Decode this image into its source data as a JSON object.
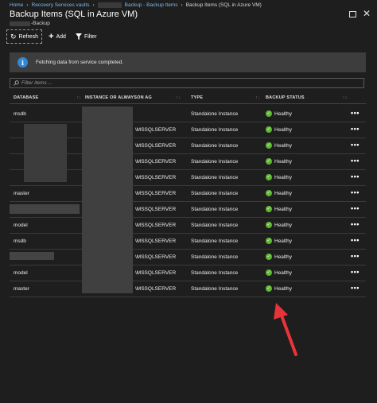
{
  "breadcrumb": {
    "items": [
      "Home",
      "Recovery Services vaults",
      "Backup - Backup Items",
      "Backup Items (SQL in Azure VM)"
    ]
  },
  "header": {
    "title": "Backup Items (SQL in Azure VM)",
    "subtitle_suffix": "-Backup"
  },
  "window": {
    "maximize_icon": "maximize-icon",
    "close_icon": "close-icon",
    "close_glyph": "✕"
  },
  "toolbar": {
    "refresh_label": "Refresh",
    "add_label": "Add",
    "filter_label": "Filter"
  },
  "info": {
    "icon_glyph": "i",
    "message": "Fetching data from service completed."
  },
  "filter": {
    "placeholder": "Filter items ..."
  },
  "table": {
    "headers": {
      "database": "DATABASE",
      "instance": "INSTANCE OR ALWAYSON AG",
      "type": "TYPE",
      "status": "BACKUP STATUS"
    },
    "rows": [
      {
        "database": "msdb",
        "instance": "",
        "type": "Standalone Instance",
        "status": "Healthy"
      },
      {
        "database": "",
        "instance": "\\MSSQLSERVER",
        "type": "Standalone Instance",
        "status": "Healthy"
      },
      {
        "database": "",
        "instance": "\\MSSQLSERVER",
        "type": "Standalone Instance",
        "status": "Healthy"
      },
      {
        "database": "",
        "instance": "\\MSSQLSERVER",
        "type": "Standalone Instance",
        "status": "Healthy"
      },
      {
        "database": "",
        "instance": "\\MSSQLSERVER",
        "type": "Standalone Instance",
        "status": "Healthy"
      },
      {
        "database": "master",
        "instance": "\\MSSQLSERVER",
        "type": "Standalone Instance",
        "status": "Healthy"
      },
      {
        "database": "",
        "instance": "\\MSSQLSERVER",
        "type": "Standalone Instance",
        "status": "Healthy"
      },
      {
        "database": "model",
        "instance": "\\MSSQLSERVER",
        "type": "Standalone Instance",
        "status": "Healthy"
      },
      {
        "database": "msdb",
        "instance": "\\MSSQLSERVER",
        "type": "Standalone Instance",
        "status": "Healthy"
      },
      {
        "database": "",
        "instance": "\\MSSQLSERVER",
        "type": "Standalone Instance",
        "status": "Healthy"
      },
      {
        "database": "model",
        "instance": "\\MSSQLSERVER",
        "type": "Standalone Instance",
        "status": "Healthy"
      },
      {
        "database": "master",
        "instance": "\\MSSQLSERVER",
        "type": "Standalone Instance",
        "status": "Healthy"
      }
    ],
    "more_glyph": "•••"
  },
  "colors": {
    "background": "#1e1e1e",
    "info_accent": "#2f89d8",
    "healthy": "#5fb832",
    "annotation_arrow": "#e8333a"
  }
}
